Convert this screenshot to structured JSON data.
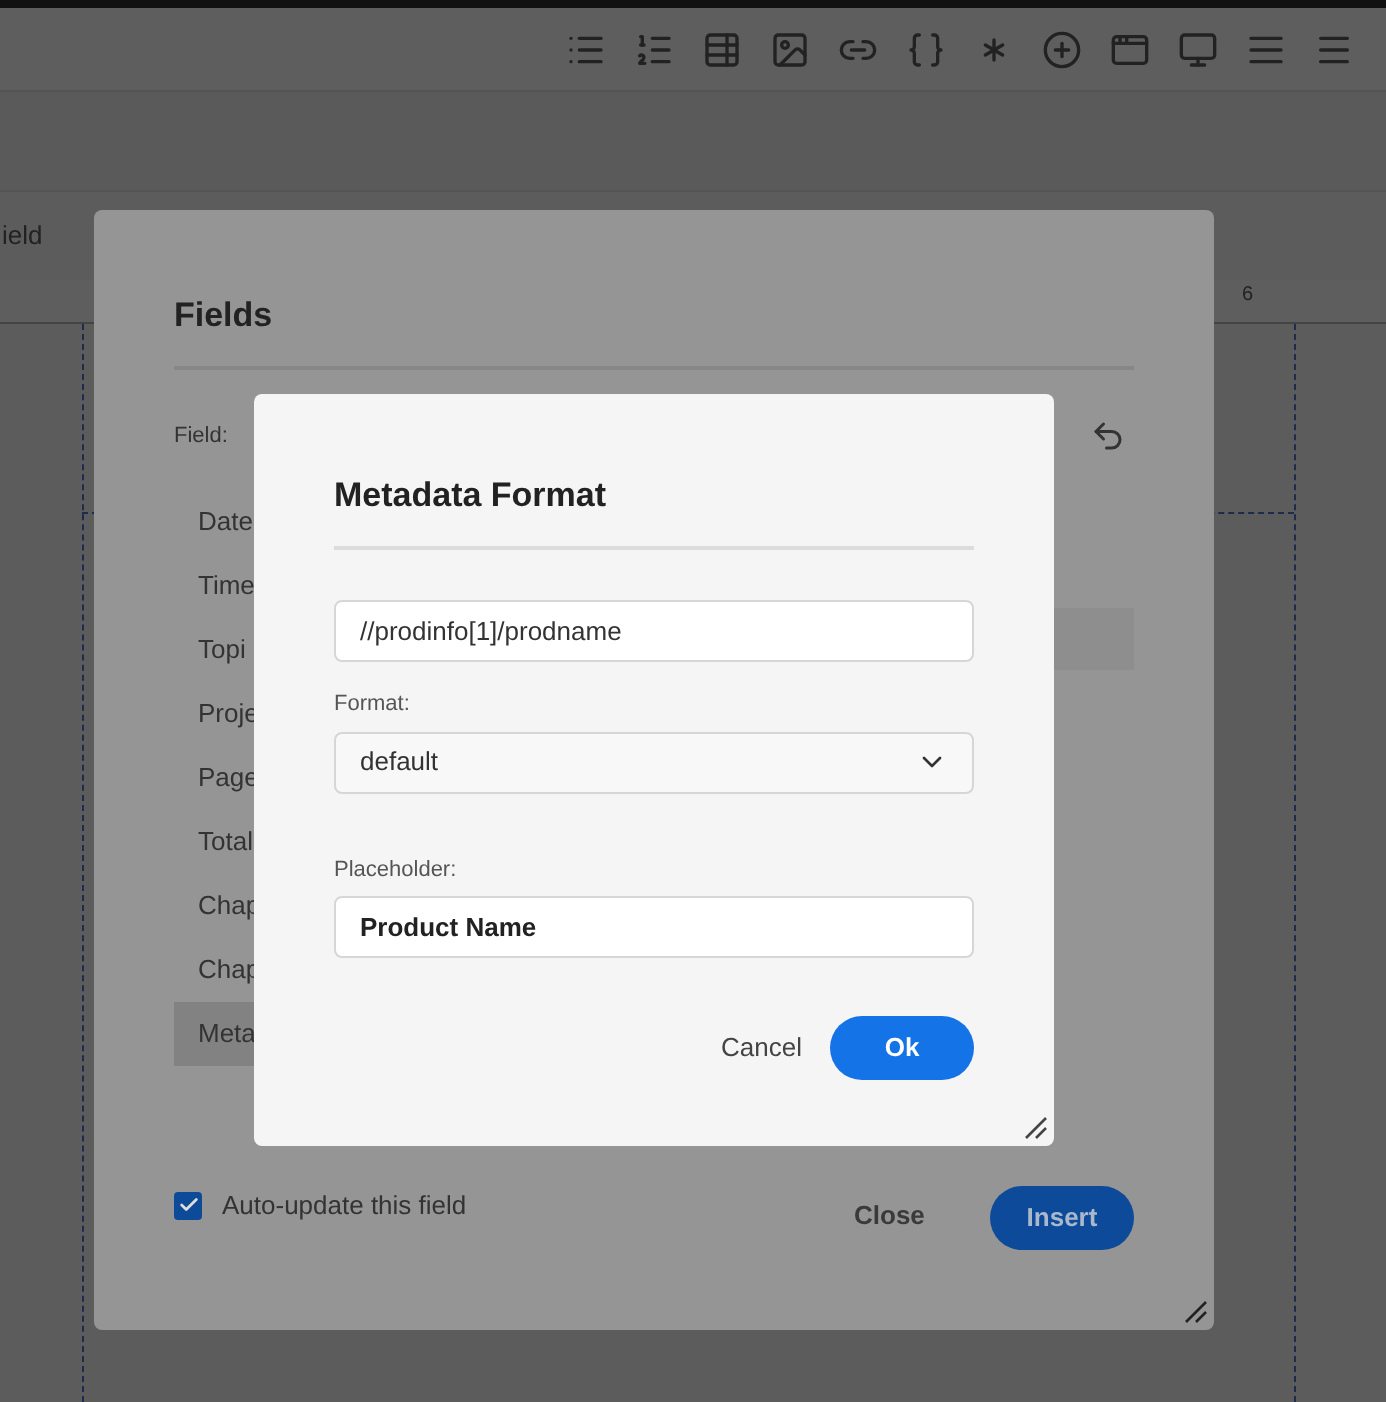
{
  "background": {
    "tab_label": "ield",
    "ruler_number": "6"
  },
  "fields_dialog": {
    "title": "Fields",
    "field_label": "Field:",
    "items": [
      {
        "label": "Date",
        "selected": false
      },
      {
        "label": "Time",
        "selected": false
      },
      {
        "label": "Topi",
        "selected": false
      },
      {
        "label": "Proje",
        "selected": false
      },
      {
        "label": "Page",
        "selected": false
      },
      {
        "label": "Total",
        "selected": false
      },
      {
        "label": "Chap",
        "selected": false
      },
      {
        "label": "Chap",
        "selected": false
      },
      {
        "label": "Meta",
        "selected": true
      }
    ],
    "auto_update": {
      "label": "Auto-update this field",
      "checked": true
    },
    "buttons": {
      "close": "Close",
      "insert": "Insert"
    }
  },
  "metadata_dialog": {
    "title": "Metadata Format",
    "xpath": "//prodinfo[1]/prodname",
    "format_label": "Format:",
    "format_value": "default",
    "placeholder_field": {
      "label": "Placeholder:",
      "value": "Product Name"
    },
    "cancel": "Cancel",
    "ok": "Ok"
  }
}
